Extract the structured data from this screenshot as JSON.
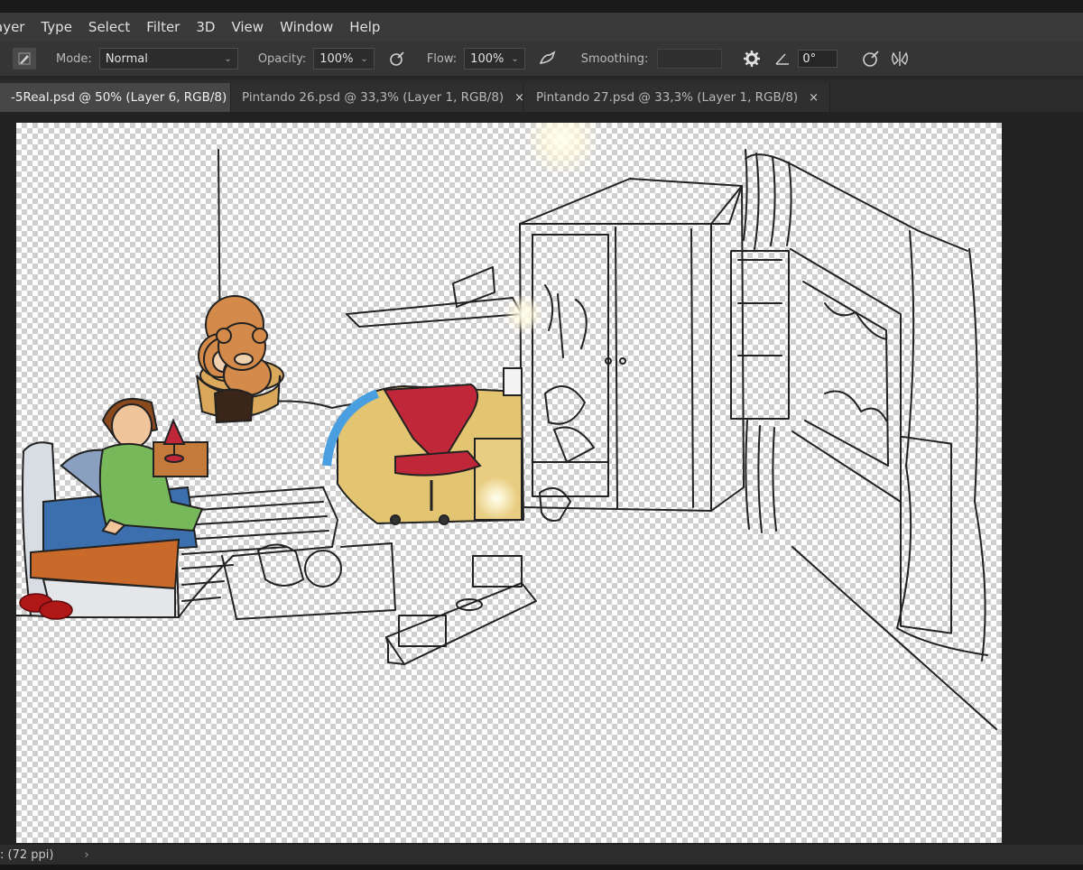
{
  "menu": {
    "items": [
      "ayer",
      "Type",
      "Select",
      "Filter",
      "3D",
      "View",
      "Window",
      "Help"
    ]
  },
  "options": {
    "mode_label": "Mode:",
    "mode_value": "Normal",
    "opacity_label": "Opacity:",
    "opacity_value": "100%",
    "flow_label": "Flow:",
    "flow_value": "100%",
    "smoothing_label": "Smoothing:",
    "smoothing_value": "",
    "angle_value": "0°",
    "icons": [
      "brush-preset-icon",
      "pressure-opacity-icon",
      "airbrush-icon",
      "gear-icon",
      "angle-icon",
      "pressure-size-icon",
      "symmetry-icon"
    ]
  },
  "tabs": [
    {
      "label": "-5Real.psd @ 50% (Layer 6, RGB/8)",
      "close": "×",
      "active": true
    },
    {
      "label": "Pintando 26.psd @ 33,3% (Layer 1, RGB/8)",
      "close": "×",
      "active": false
    },
    {
      "label": "Pintando 27.psd @ 33,3% (Layer 1, RGB/8)",
      "close": "×",
      "active": false
    }
  ],
  "status": {
    "doc_info": ": (72 ppi)",
    "arrow": "›"
  },
  "colors": {
    "menubar": "#3a3a3a",
    "active_tab": "#474747",
    "checker": "#cfcfcf"
  }
}
